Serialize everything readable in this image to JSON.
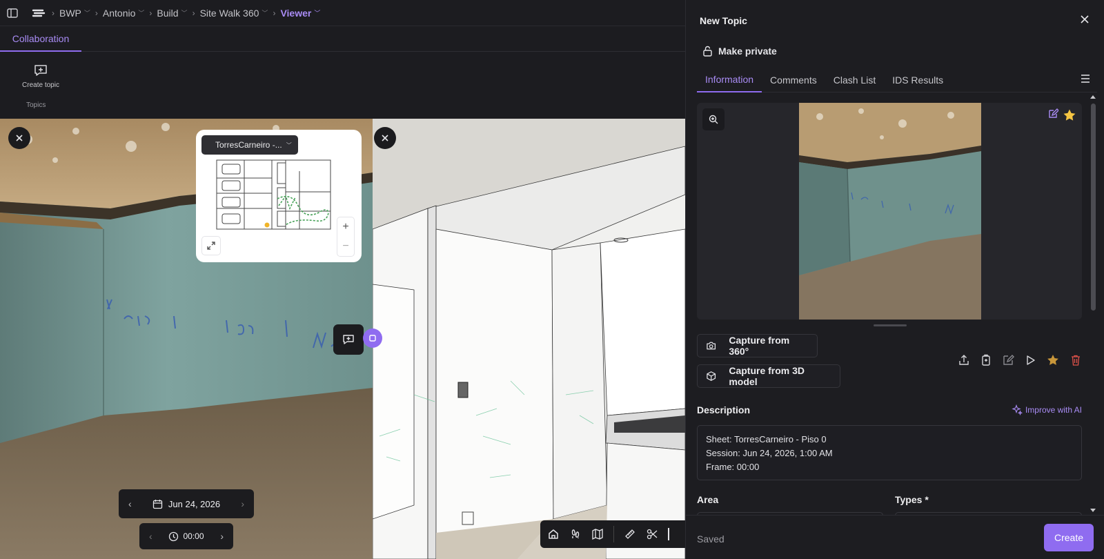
{
  "breadcrumb": [
    {
      "label": "BWP",
      "active": false
    },
    {
      "label": "Antonio",
      "active": false
    },
    {
      "label": "Build",
      "active": false
    },
    {
      "label": "Site Walk 360",
      "active": false
    },
    {
      "label": "Viewer",
      "active": true
    }
  ],
  "tabs": {
    "collaboration": "Collaboration"
  },
  "ribbon": {
    "create_topic": "Create topic",
    "group_label": "Topics"
  },
  "minimap": {
    "selected_sheet": "TorresCarneiro -..."
  },
  "view360": {
    "date": "Jun 24, 2026",
    "time": "00:00"
  },
  "panel": {
    "title": "New Topic",
    "make_private": "Make private",
    "tabs": [
      "Information",
      "Comments",
      "Clash List",
      "IDS Results"
    ],
    "active_tab": "Information",
    "capture_360": "Capture from 360°",
    "capture_3d": "Capture from 3D model",
    "description_label": "Description",
    "improve_ai": "Improve with AI",
    "description_lines": [
      "Sheet: TorresCarneiro - Piso 0",
      "Session: Jun 24, 2026, 1:00 AM",
      "Frame: 00:00"
    ],
    "area_label": "Area",
    "types_label": "Types *",
    "status": "Saved",
    "create_button": "Create"
  },
  "colors": {
    "accent": "#8f6cf0",
    "accent_text": "#a98cf5",
    "star": "#f5c542",
    "delete": "#e0524a"
  },
  "icons": [
    "sidebar-toggle-icon",
    "app-logo-icon",
    "create-topic-icon",
    "close-icon",
    "expand-icon",
    "calendar-icon",
    "clock-icon",
    "home-icon",
    "walk-icon",
    "map-icon",
    "measure-icon",
    "scissors-icon",
    "lock-open-icon",
    "menu-icon",
    "zoom-in-icon",
    "edit-icon",
    "star-icon",
    "camera-icon",
    "cube-icon",
    "share-icon",
    "copy-icon",
    "play-icon",
    "delete-icon",
    "sparkles-icon"
  ]
}
